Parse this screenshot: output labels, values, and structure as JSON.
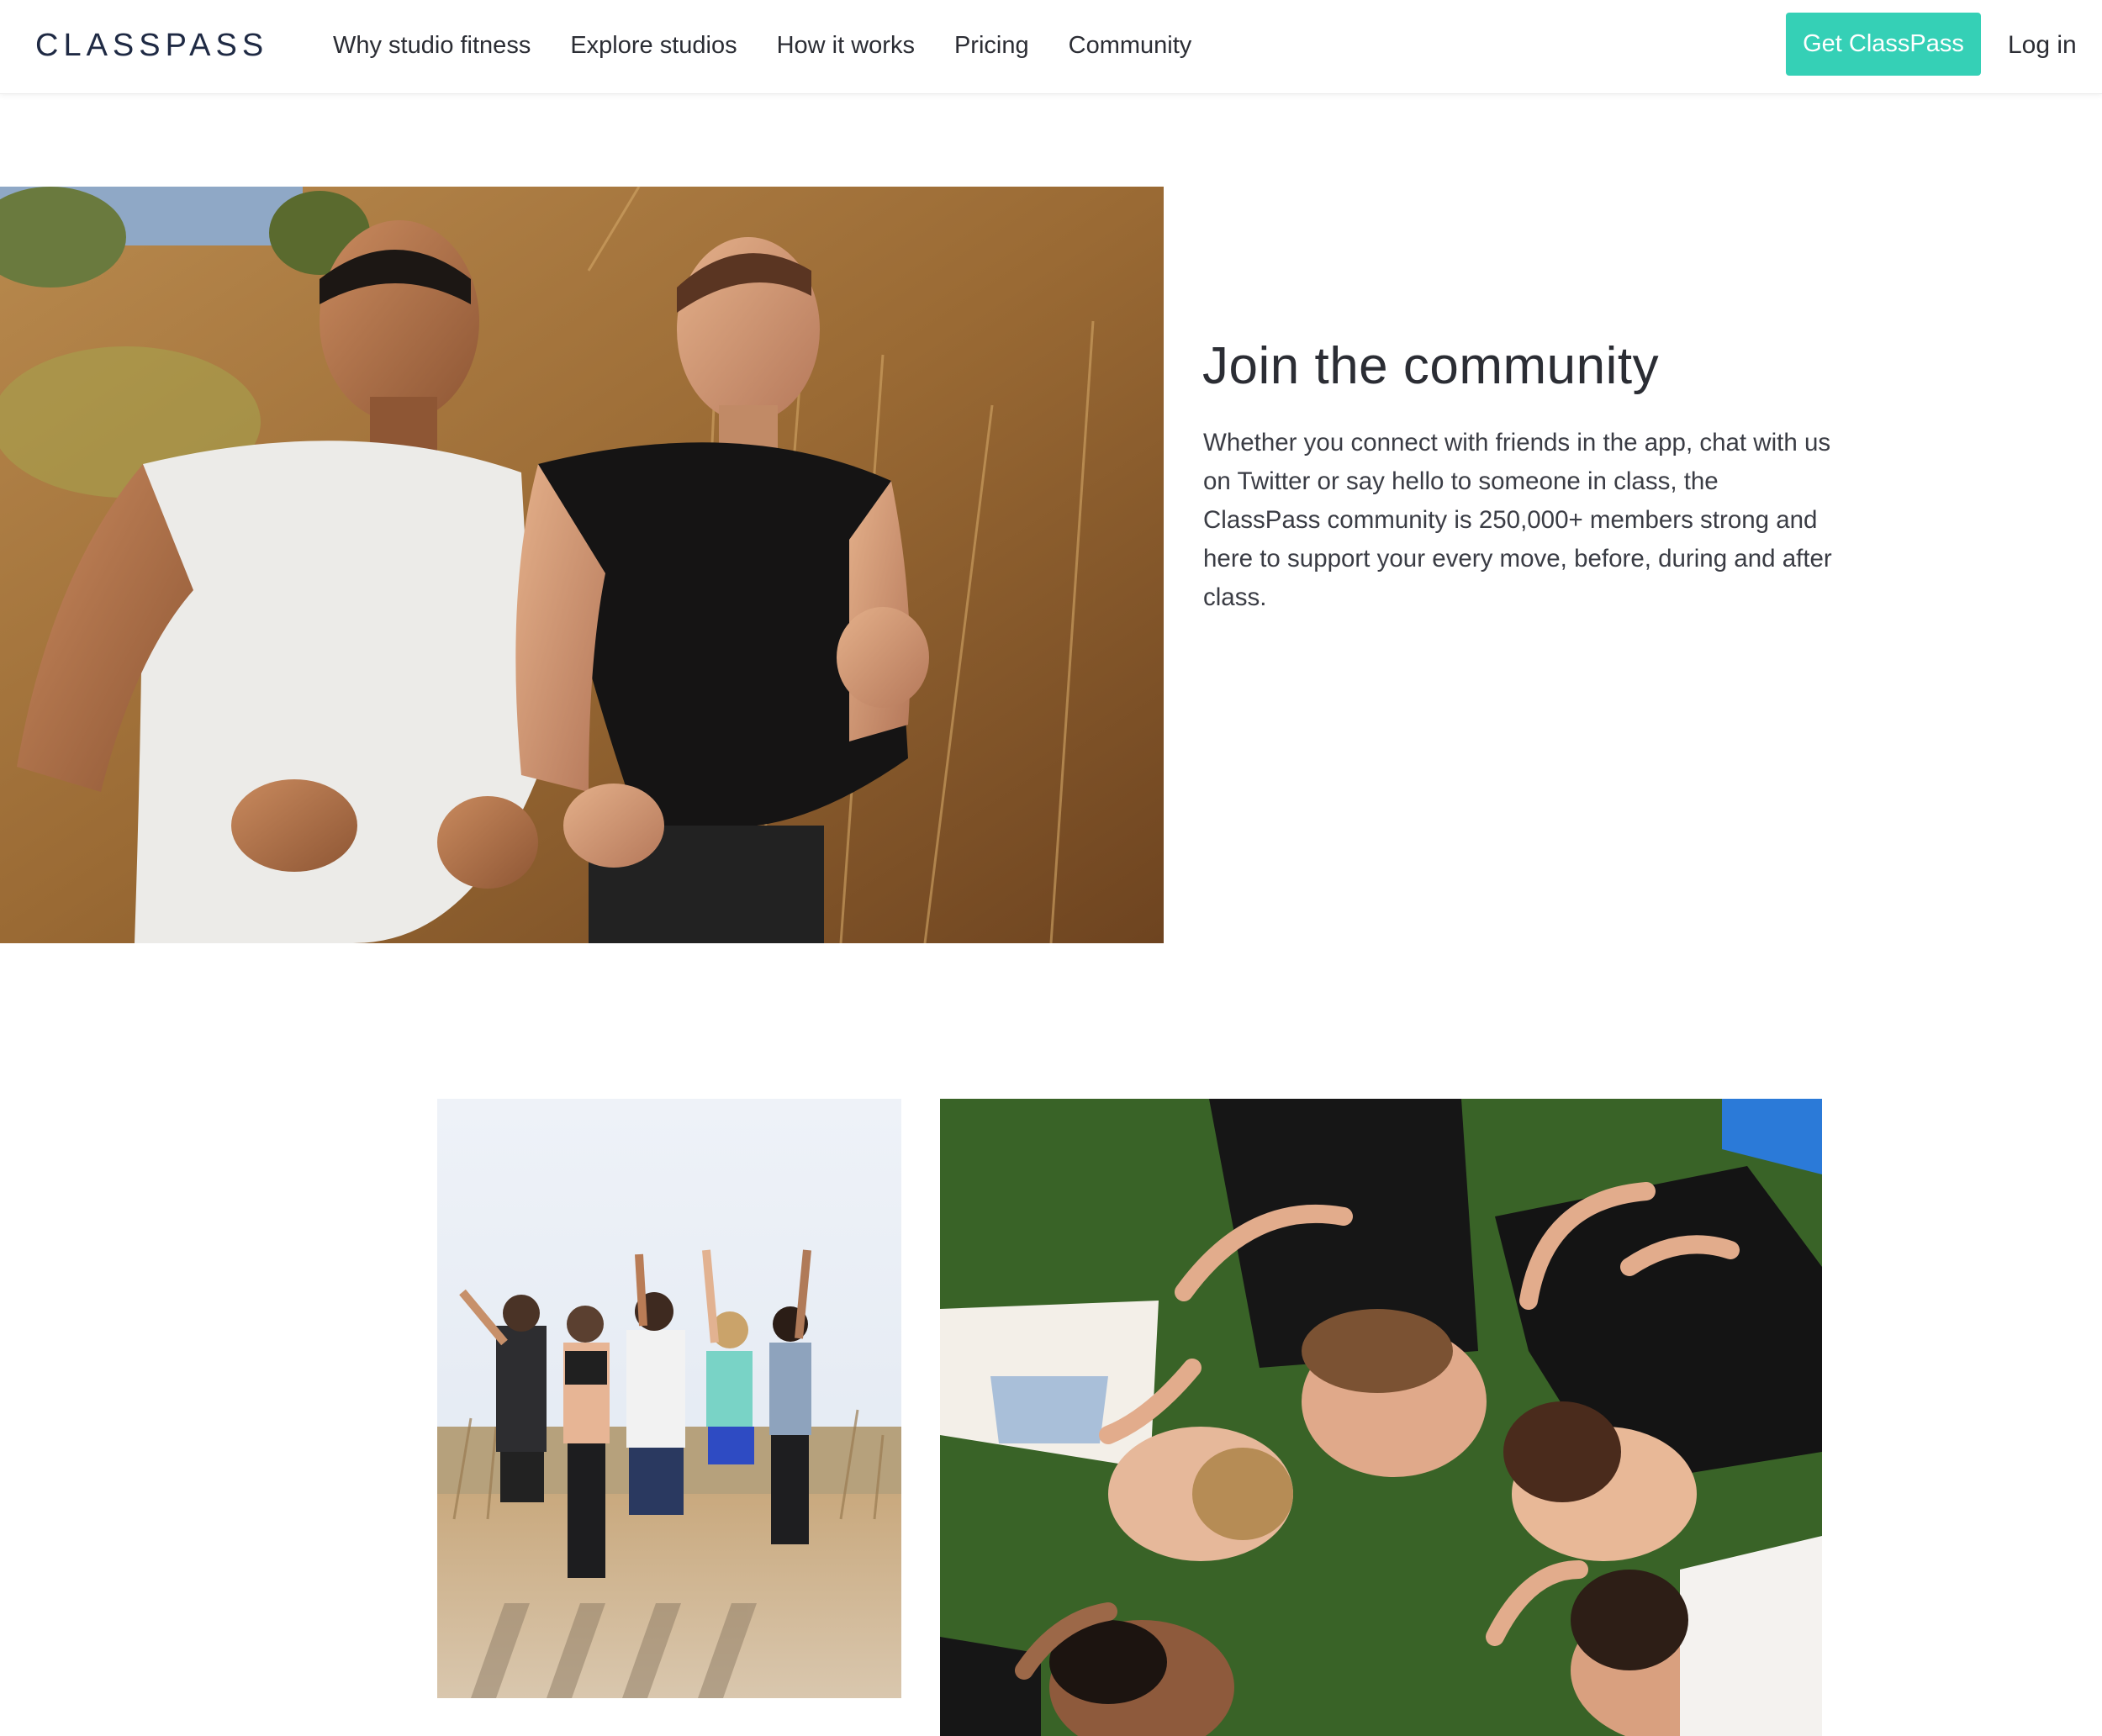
{
  "header": {
    "logo": "CLASSPASS",
    "nav": [
      {
        "label": "Why studio fitness"
      },
      {
        "label": "Explore studios"
      },
      {
        "label": "How it works"
      },
      {
        "label": "Pricing"
      },
      {
        "label": "Community"
      }
    ],
    "cta_label": "Get ClassPass",
    "login_label": "Log in"
  },
  "community": {
    "title": "Join the community",
    "body": "Whether you connect with friends in the app, chat with us on Twitter or say hello to someone in class, the ClassPass community is 250,000+ members strong and here to support your every move, before, during and after class."
  },
  "colors": {
    "accent": "#35d0b6",
    "logo": "#1f2a44",
    "text": "#2b2d34"
  }
}
